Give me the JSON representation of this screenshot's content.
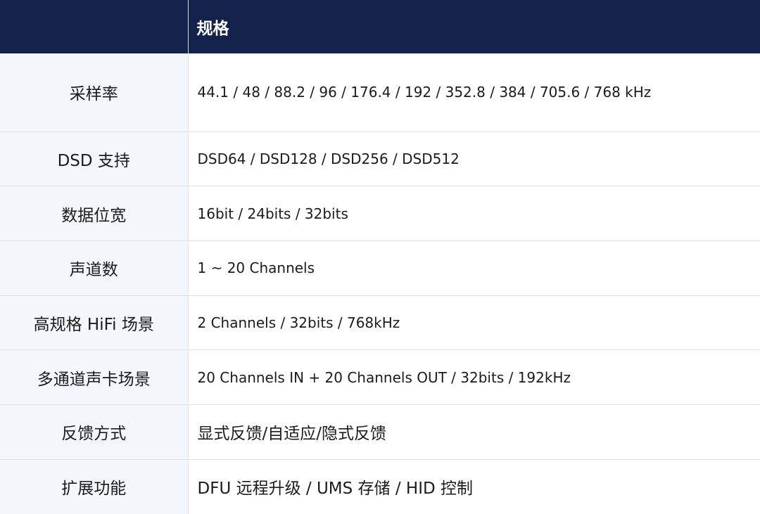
{
  "table": {
    "header": {
      "label": "",
      "value": "规格"
    },
    "rows": [
      {
        "label": "采样率",
        "value": "44.1 / 48 / 88.2 / 96 / 176.4 / 192 / 352.8 / 384 / 705.6 / 768 kHz"
      },
      {
        "label": "DSD 支持",
        "value": "DSD64 / DSD128 / DSD256 / DSD512"
      },
      {
        "label": "数据位宽",
        "value": "16bit / 24bits / 32bits"
      },
      {
        "label": "声道数",
        "value": "1 ~ 20 Channels"
      },
      {
        "label": "高规格 HiFi 场景",
        "value": "2 Channels / 32bits / 768kHz"
      },
      {
        "label": "多通道声卡场景",
        "value": "20 Channels IN + 20 Channels OUT / 32bits / 192kHz"
      },
      {
        "label": "反馈方式",
        "value": "显式反馈/自适应/隐式反馈"
      },
      {
        "label": "扩展功能",
        "value": "DFU 远程升级 / UMS 存储 / HID 控制"
      }
    ]
  },
  "colors": {
    "header_bg": "#13224a",
    "header_text": "#ffffff",
    "label_bg": "#f3f6fb",
    "border": "#d9e1ec"
  }
}
